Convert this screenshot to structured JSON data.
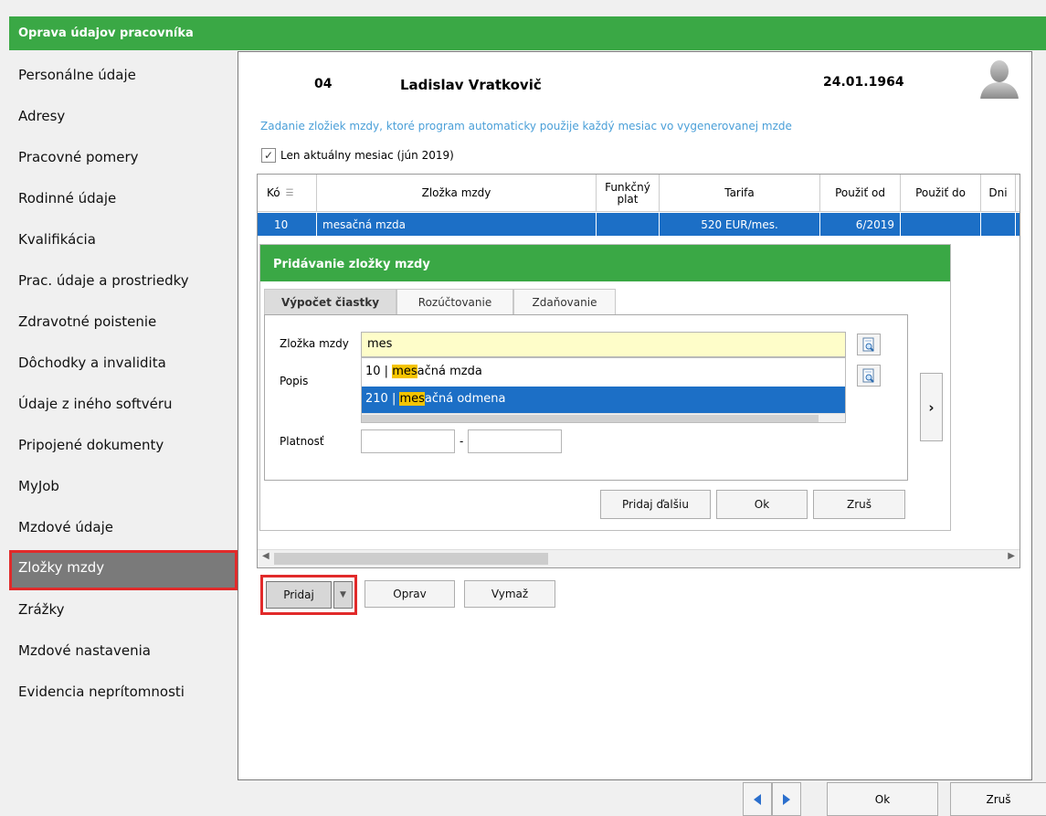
{
  "window": {
    "title": "Oprava údajov pracovníka"
  },
  "sidebar": {
    "items": [
      {
        "label": "Personálne údaje"
      },
      {
        "label": "Adresy"
      },
      {
        "label": "Pracovné pomery"
      },
      {
        "label": "Rodinné údaje"
      },
      {
        "label": "Kvalifikácia"
      },
      {
        "label": "Prac. údaje a prostriedky"
      },
      {
        "label": "Zdravotné poistenie"
      },
      {
        "label": "Dôchodky a invalidita"
      },
      {
        "label": "Údaje z iného softvéru"
      },
      {
        "label": "Pripojené dokumenty"
      },
      {
        "label": "MyJob"
      },
      {
        "label": "Mzdové údaje"
      },
      {
        "label": "Zložky mzdy"
      },
      {
        "label": "Zrážky"
      },
      {
        "label": "Mzdové nastavenia"
      },
      {
        "label": "Evidencia neprítomnosti"
      }
    ],
    "active_index": 12
  },
  "employee": {
    "number": "04",
    "name": "Ladislav Vratkovič",
    "birth_date": "24.01.1964"
  },
  "main": {
    "info_text": "Zadanie zložiek mzdy, ktoré program automaticky použije každý mesiac vo vygenerovanej mzde",
    "checkbox": {
      "label": "Len aktuálny mesiac (jún 2019)",
      "checked": true,
      "mark": "✓"
    },
    "grid": {
      "columns": [
        "Kó",
        "Zložka mzdy",
        "Funkčný plat",
        "Tarifa",
        "Použiť od",
        "Použiť do",
        "Dni"
      ],
      "rows": [
        {
          "code": "10",
          "name": "mesačná mzda",
          "func": "",
          "tarifa": "520 EUR/mes.",
          "od": "6/2019",
          "do": "",
          "dni": ""
        }
      ]
    },
    "buttons": {
      "add": "Pridaj",
      "edit": "Oprav",
      "delete": "Vymaž"
    }
  },
  "dialog": {
    "title": "Pridávanie zložky mzdy",
    "tabs": [
      "Výpočet čiastky",
      "Rozúčtovanie",
      "Zdaňovanie"
    ],
    "active_tab": 0,
    "fields": {
      "zlozka_label": "Zložka mzdy",
      "zlozka_value": "mes",
      "popis_label": "Popis",
      "platnost_label": "Platnosť",
      "platnost_sep": "-"
    },
    "dropdown": [
      {
        "prefix": "10 | ",
        "match": "mes",
        "rest": "ačná mzda"
      },
      {
        "prefix": "210 | ",
        "match": "mes",
        "rest": "ačná odmena"
      }
    ],
    "dropdown_selected": 1,
    "buttons": {
      "add_next": "Pridaj ďalšiu",
      "ok": "Ok",
      "cancel": "Zruš"
    }
  },
  "footer": {
    "ok": "Ok",
    "cancel": "Zruš"
  },
  "colors": {
    "accent_green": "#3aa845",
    "selection_blue": "#1c6fc6",
    "highlight_red": "#e12a2a",
    "info_blue": "#4a9fd8"
  }
}
